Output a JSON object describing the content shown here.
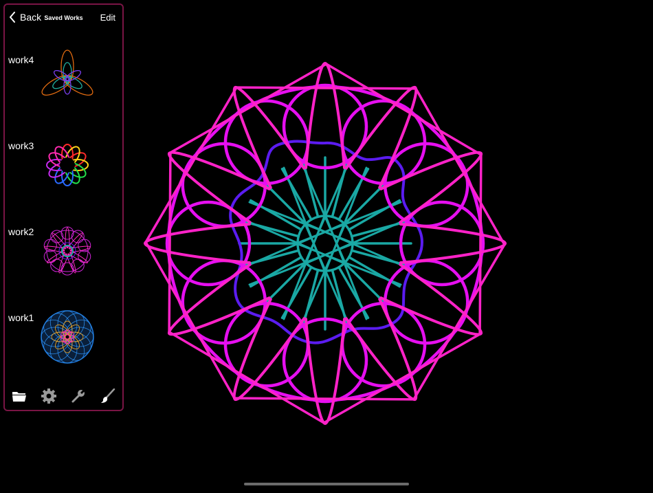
{
  "sidebar": {
    "back_label": "Back",
    "title": "Saved Works",
    "edit_label": "Edit",
    "works": [
      {
        "label": "work4"
      },
      {
        "label": "work3"
      },
      {
        "label": "work2"
      },
      {
        "label": "work1"
      }
    ],
    "border_color": "#7a1545"
  },
  "toolbar": {
    "icons": [
      "folder-icon",
      "gear-icon",
      "wrench-icon",
      "brush-icon"
    ]
  },
  "canvas": {
    "background": "#000000",
    "colors": {
      "magenta": "#e60ff0",
      "pink": "#ff22c8",
      "violet": "#5b1cf0",
      "teal": "#1aa8a4"
    }
  }
}
